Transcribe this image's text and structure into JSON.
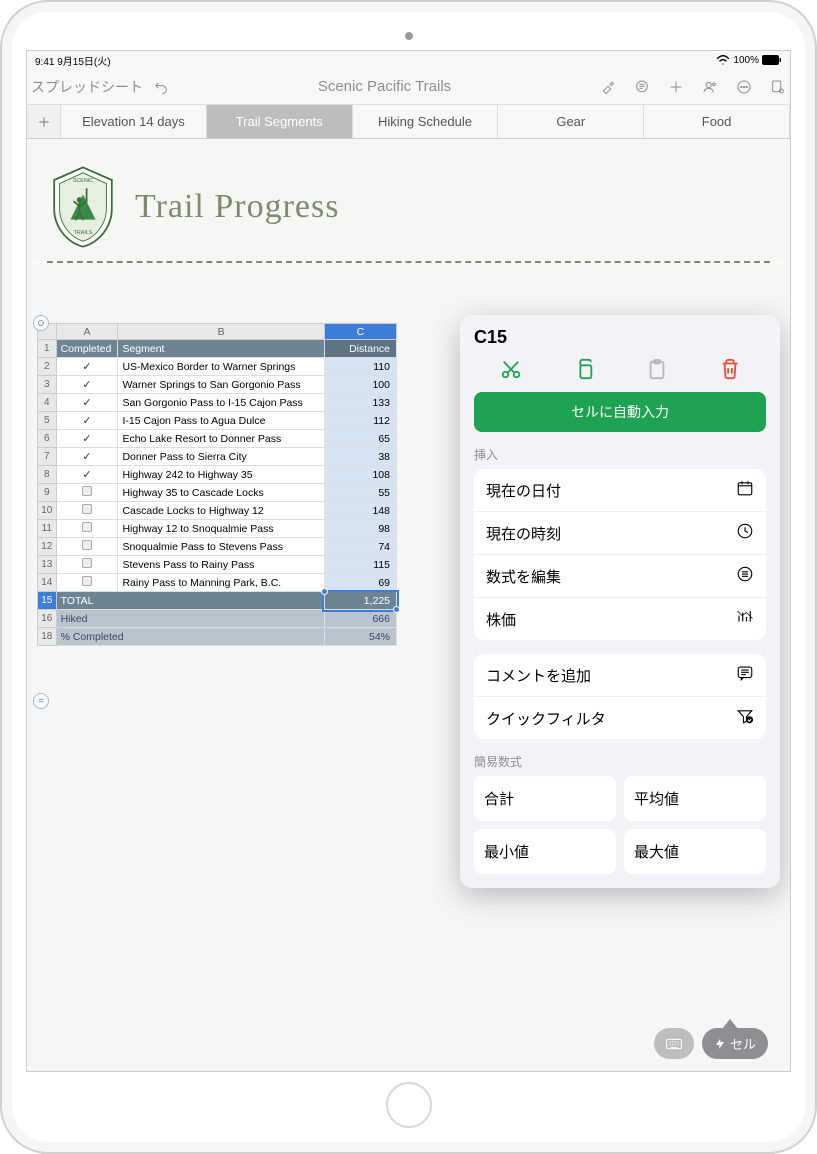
{
  "status": {
    "time": "9:41",
    "date": "9月15日(火)",
    "battery": "100%"
  },
  "toolbar": {
    "back_label": "スプレッドシート",
    "title": "Scenic Pacific Trails"
  },
  "tabs": [
    "Elevation 14 days",
    "Trail Segments",
    "Hiking Schedule",
    "Gear",
    "Food"
  ],
  "active_tab_index": 1,
  "sheet": {
    "title": "Trail Progress"
  },
  "table": {
    "columns": [
      "A",
      "B",
      "C"
    ],
    "headers": {
      "a": "Completed",
      "b": "Segment",
      "c": "Distance"
    },
    "rows": [
      {
        "n": 2,
        "done": true,
        "seg": "US-Mexico Border to Warner Springs",
        "dist": "110"
      },
      {
        "n": 3,
        "done": true,
        "seg": "Warner Springs to San Gorgonio Pass",
        "dist": "100"
      },
      {
        "n": 4,
        "done": true,
        "seg": "San Gorgonio Pass to I-15 Cajon Pass",
        "dist": "133"
      },
      {
        "n": 5,
        "done": true,
        "seg": "I-15 Cajon Pass to Agua Dulce",
        "dist": "112"
      },
      {
        "n": 6,
        "done": true,
        "seg": "Echo Lake Resort to Donner Pass",
        "dist": "65"
      },
      {
        "n": 7,
        "done": true,
        "seg": "Donner Pass to Sierra City",
        "dist": "38"
      },
      {
        "n": 8,
        "done": true,
        "seg": "Highway 242 to Highway 35",
        "dist": "108"
      },
      {
        "n": 9,
        "done": false,
        "seg": "Highway 35 to Cascade Locks",
        "dist": "55"
      },
      {
        "n": 10,
        "done": false,
        "seg": "Cascade Locks to Highway 12",
        "dist": "148"
      },
      {
        "n": 11,
        "done": false,
        "seg": "Highway 12 to Snoqualmie Pass",
        "dist": "98"
      },
      {
        "n": 12,
        "done": false,
        "seg": "Snoqualmie Pass to Stevens Pass",
        "dist": "74"
      },
      {
        "n": 13,
        "done": false,
        "seg": "Stevens Pass to Rainy Pass",
        "dist": "115"
      },
      {
        "n": 14,
        "done": false,
        "seg": "Rainy Pass to Manning Park, B.C.",
        "dist": "69"
      }
    ],
    "summary": {
      "total_label": "TOTAL",
      "total_val": "1,225",
      "hiked_label": "Hiked",
      "hiked_val": "666",
      "pct_label": "% Completed",
      "pct_val": "54%",
      "total_row": 15,
      "hiked_row": 16,
      "pct_row": 18
    }
  },
  "popover": {
    "cell_ref": "C15",
    "autofill": "セルに自動入力",
    "insert_label": "挿入",
    "insert_items": [
      "現在の日付",
      "現在の時刻",
      "数式を編集",
      "株価"
    ],
    "more_items": [
      "コメントを追加",
      "クイックフィルタ"
    ],
    "formula_label": "簡易数式",
    "formulas": [
      "合計",
      "平均値",
      "最小値",
      "最大値"
    ]
  },
  "bottom": {
    "cell_label": "セル"
  }
}
